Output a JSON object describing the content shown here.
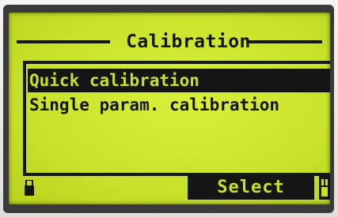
{
  "screen": {
    "title": "Calibration",
    "menu": {
      "items": [
        {
          "label": "Quick calibration",
          "selected": true
        },
        {
          "label": "Single param. calibration",
          "selected": false
        }
      ]
    },
    "softkey": {
      "label": "Select"
    }
  },
  "colors": {
    "lcd_background": "#c9e22a",
    "lcd_text": "#151515"
  },
  "icons": {
    "footer_left": "lock-icon",
    "footer_right": "backlight-icon"
  }
}
